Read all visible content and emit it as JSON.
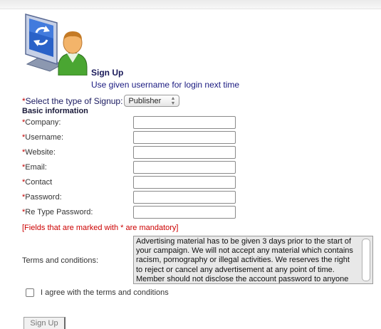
{
  "header": {
    "title": "Sign Up",
    "subtitle": "Use given username for login next time"
  },
  "signup_type": {
    "required_mark": "*",
    "label": "Select the type of Signup:",
    "selected": "Publisher"
  },
  "section_title": "Basic information",
  "fields": [
    {
      "required_mark": "*",
      "label": "Company:",
      "value": ""
    },
    {
      "required_mark": "*",
      "label": "Username:",
      "value": ""
    },
    {
      "required_mark": "*",
      "label": "Website:",
      "value": ""
    },
    {
      "required_mark": "*",
      "label": "Email:",
      "value": ""
    },
    {
      "required_mark": "*",
      "label": "Contact",
      "value": ""
    },
    {
      "required_mark": "*",
      "label": "Password:",
      "value": ""
    },
    {
      "required_mark": "*",
      "label": "Re Type Password:",
      "value": ""
    }
  ],
  "mandatory_note": "[Fields that are marked with * are mandatory]",
  "terms": {
    "label": "Terms and conditions:",
    "text": "Advertising material has to be given 3 days prior to the start of your campaign. We will not accept any material which contains racism, pornography or illegal activities. We reserves the right to reject or cancel any advertisement at any point of time. Member should not disclose the account password to anyone else and"
  },
  "agree": {
    "label": "I agree with the terms and conditions",
    "checked": false
  },
  "submit": {
    "label": "Sign Up"
  },
  "icons": {
    "logo": "monitor-user-refresh-icon",
    "select_arrows": "up-down-arrows-icon"
  },
  "colors": {
    "required": "#c00000",
    "mandatory_note": "#cc0000",
    "title": "#1a1a5a"
  }
}
